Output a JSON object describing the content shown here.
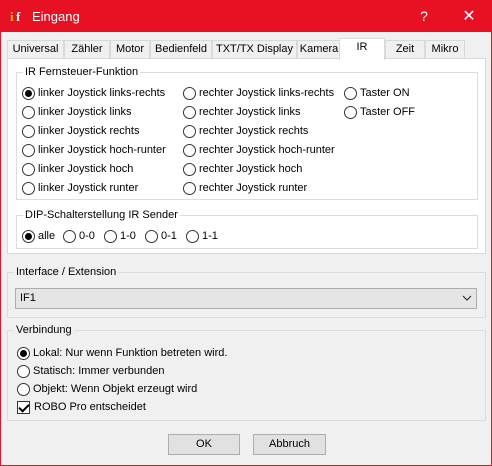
{
  "window": {
    "title": "Eingang",
    "help": "?",
    "close": "✕"
  },
  "tabs": [
    "Universal",
    "Zähler",
    "Motor",
    "Bedienfeld",
    "TXT/TX Display",
    "Kamera",
    "IR",
    "Zeit",
    "Mikro"
  ],
  "active_tab": "IR",
  "ir_group": {
    "label": "IR Fernsteuer-Funktion",
    "col1": [
      "linker Joystick links-rechts",
      "linker Joystick links",
      "linker Joystick rechts",
      "linker Joystick hoch-runter",
      "linker Joystick hoch",
      "linker Joystick runter"
    ],
    "col2": [
      "rechter Joystick links-rechts",
      "rechter Joystick links",
      "rechter Joystick rechts",
      "rechter Joystick hoch-runter",
      "rechter Joystick hoch",
      "rechter Joystick runter"
    ],
    "col3": [
      "Taster ON",
      "Taster OFF"
    ],
    "selected": "linker Joystick links-rechts"
  },
  "dip_group": {
    "label": "DIP-Schalterstellung IR Sender",
    "options": [
      "alle",
      "0-0",
      "1-0",
      "0-1",
      "1-1"
    ],
    "selected": "alle"
  },
  "interface_group": {
    "label": "Interface / Extension",
    "value": "IF1"
  },
  "verbindung_group": {
    "label": "Verbindung",
    "options": [
      "Lokal: Nur wenn Funktion betreten wird.",
      "Statisch: Immer verbunden",
      "Objekt: Wenn Objekt erzeugt wird"
    ],
    "selected": "Lokal: Nur wenn Funktion betreten wird.",
    "checkbox_label": "ROBO Pro entscheidet",
    "checkbox_checked": true
  },
  "buttons": {
    "ok": "OK",
    "cancel": "Abbruch"
  },
  "colors": {
    "titlebar": "#e81123",
    "panel": "#f0f0f0"
  }
}
